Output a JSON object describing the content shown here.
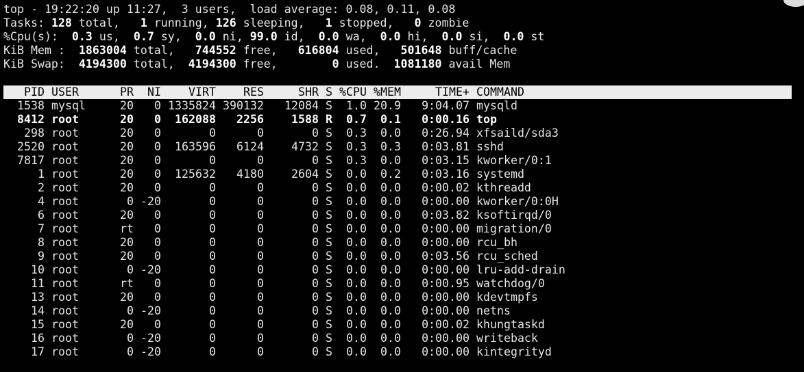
{
  "summary": {
    "l1": "top - 19:22:20 up 11:27,  3 users,  load average: 0.08, 0.11, 0.08",
    "tasks": {
      "label": "Tasks: ",
      "total": "128",
      "total_lbl": " total,   ",
      "running": "1",
      "running_lbl": " running, ",
      "sleeping": "126",
      "sleeping_lbl": " sleeping,   ",
      "stopped": "1",
      "stopped_lbl": " stopped,   ",
      "zombie": "0",
      "zombie_lbl": " zombie"
    },
    "cpu": {
      "label": "%Cpu(s):  ",
      "us": "0.3",
      "us_lbl": " us,  ",
      "sy": "0.7",
      "sy_lbl": " sy,  ",
      "ni": "0.0",
      "ni_lbl": " ni, ",
      "id": "99.0",
      "id_lbl": " id,  ",
      "wa": "0.0",
      "wa_lbl": " wa,  ",
      "hi": "0.0",
      "hi_lbl": " hi,  ",
      "si": "0.0",
      "si_lbl": " si,  ",
      "st": "0.0",
      "st_lbl": " st"
    },
    "mem": {
      "label": "KiB Mem :  ",
      "total": "1863004",
      "total_lbl": " total,   ",
      "free": "744552",
      "free_lbl": " free,   ",
      "used": "616804",
      "used_lbl": " used,   ",
      "buff": "501648",
      "buff_lbl": " buff/cache"
    },
    "swap": {
      "label": "KiB Swap:  ",
      "total": "4194300",
      "total_lbl": " total,  ",
      "free": "4194300",
      "free_lbl": " free,        ",
      "used": "0",
      "used_lbl": " used.  ",
      "avail": "1081180",
      "avail_lbl": " avail Mem"
    }
  },
  "columns": [
    "PID",
    "USER",
    "PR",
    "NI",
    "VIRT",
    "RES",
    "SHR",
    "S",
    "%CPU",
    "%MEM",
    "TIME+",
    "COMMAND"
  ],
  "processes": [
    {
      "pid": "1538",
      "user": "mysql",
      "pr": "20",
      "ni": "0",
      "virt": "1335824",
      "res": "390132",
      "shr": "12084",
      "s": "S",
      "cpu": "1.0",
      "mem": "20.9",
      "time": "9:04.07",
      "cmd": "mysqld"
    },
    {
      "pid": "8412",
      "user": "root",
      "pr": "20",
      "ni": "0",
      "virt": "162088",
      "res": "2256",
      "shr": "1588",
      "s": "R",
      "cpu": "0.7",
      "mem": "0.1",
      "time": "0:00.16",
      "cmd": "top"
    },
    {
      "pid": "298",
      "user": "root",
      "pr": "20",
      "ni": "0",
      "virt": "0",
      "res": "0",
      "shr": "0",
      "s": "S",
      "cpu": "0.3",
      "mem": "0.0",
      "time": "0:26.94",
      "cmd": "xfsaild/sda3"
    },
    {
      "pid": "2520",
      "user": "root",
      "pr": "20",
      "ni": "0",
      "virt": "163596",
      "res": "6124",
      "shr": "4732",
      "s": "S",
      "cpu": "0.3",
      "mem": "0.3",
      "time": "0:03.81",
      "cmd": "sshd"
    },
    {
      "pid": "7817",
      "user": "root",
      "pr": "20",
      "ni": "0",
      "virt": "0",
      "res": "0",
      "shr": "0",
      "s": "S",
      "cpu": "0.3",
      "mem": "0.0",
      "time": "0:03.15",
      "cmd": "kworker/0:1"
    },
    {
      "pid": "1",
      "user": "root",
      "pr": "20",
      "ni": "0",
      "virt": "125632",
      "res": "4180",
      "shr": "2604",
      "s": "S",
      "cpu": "0.0",
      "mem": "0.2",
      "time": "0:03.16",
      "cmd": "systemd"
    },
    {
      "pid": "2",
      "user": "root",
      "pr": "20",
      "ni": "0",
      "virt": "0",
      "res": "0",
      "shr": "0",
      "s": "S",
      "cpu": "0.0",
      "mem": "0.0",
      "time": "0:00.02",
      "cmd": "kthreadd"
    },
    {
      "pid": "4",
      "user": "root",
      "pr": "0",
      "ni": "-20",
      "virt": "0",
      "res": "0",
      "shr": "0",
      "s": "S",
      "cpu": "0.0",
      "mem": "0.0",
      "time": "0:00.00",
      "cmd": "kworker/0:0H"
    },
    {
      "pid": "6",
      "user": "root",
      "pr": "20",
      "ni": "0",
      "virt": "0",
      "res": "0",
      "shr": "0",
      "s": "S",
      "cpu": "0.0",
      "mem": "0.0",
      "time": "0:03.82",
      "cmd": "ksoftirqd/0"
    },
    {
      "pid": "7",
      "user": "root",
      "pr": "rt",
      "ni": "0",
      "virt": "0",
      "res": "0",
      "shr": "0",
      "s": "S",
      "cpu": "0.0",
      "mem": "0.0",
      "time": "0:00.00",
      "cmd": "migration/0"
    },
    {
      "pid": "8",
      "user": "root",
      "pr": "20",
      "ni": "0",
      "virt": "0",
      "res": "0",
      "shr": "0",
      "s": "S",
      "cpu": "0.0",
      "mem": "0.0",
      "time": "0:00.00",
      "cmd": "rcu_bh"
    },
    {
      "pid": "9",
      "user": "root",
      "pr": "20",
      "ni": "0",
      "virt": "0",
      "res": "0",
      "shr": "0",
      "s": "S",
      "cpu": "0.0",
      "mem": "0.0",
      "time": "0:03.56",
      "cmd": "rcu_sched"
    },
    {
      "pid": "10",
      "user": "root",
      "pr": "0",
      "ni": "-20",
      "virt": "0",
      "res": "0",
      "shr": "0",
      "s": "S",
      "cpu": "0.0",
      "mem": "0.0",
      "time": "0:00.00",
      "cmd": "lru-add-drain"
    },
    {
      "pid": "11",
      "user": "root",
      "pr": "rt",
      "ni": "0",
      "virt": "0",
      "res": "0",
      "shr": "0",
      "s": "S",
      "cpu": "0.0",
      "mem": "0.0",
      "time": "0:00.95",
      "cmd": "watchdog/0"
    },
    {
      "pid": "13",
      "user": "root",
      "pr": "20",
      "ni": "0",
      "virt": "0",
      "res": "0",
      "shr": "0",
      "s": "S",
      "cpu": "0.0",
      "mem": "0.0",
      "time": "0:00.00",
      "cmd": "kdevtmpfs"
    },
    {
      "pid": "14",
      "user": "root",
      "pr": "0",
      "ni": "-20",
      "virt": "0",
      "res": "0",
      "shr": "0",
      "s": "S",
      "cpu": "0.0",
      "mem": "0.0",
      "time": "0:00.00",
      "cmd": "netns"
    },
    {
      "pid": "15",
      "user": "root",
      "pr": "20",
      "ni": "0",
      "virt": "0",
      "res": "0",
      "shr": "0",
      "s": "S",
      "cpu": "0.0",
      "mem": "0.0",
      "time": "0:00.02",
      "cmd": "khungtaskd"
    },
    {
      "pid": "16",
      "user": "root",
      "pr": "0",
      "ni": "-20",
      "virt": "0",
      "res": "0",
      "shr": "0",
      "s": "S",
      "cpu": "0.0",
      "mem": "0.0",
      "time": "0:00.00",
      "cmd": "writeback"
    },
    {
      "pid": "17",
      "user": "root",
      "pr": "0",
      "ni": "-20",
      "virt": "0",
      "res": "0",
      "shr": "0",
      "s": "S",
      "cpu": "0.0",
      "mem": "0.0",
      "time": "0:00.00",
      "cmd": "kintegrityd"
    }
  ],
  "highlight_row_index": 1,
  "colors": {
    "background": "#000000",
    "text": "#e6e6e6",
    "bold_text": "#ffffff",
    "header_bg": "#ececec",
    "header_text": "#000000"
  }
}
